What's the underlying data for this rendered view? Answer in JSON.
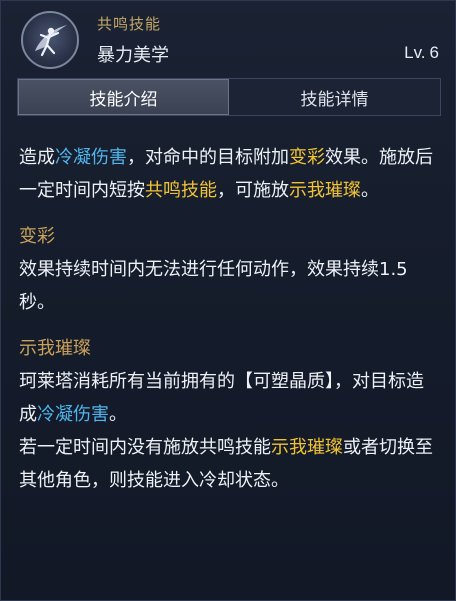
{
  "header": {
    "category": "共鸣技能",
    "skill_name": "暴力美学",
    "level_prefix": "Lv.",
    "level": "6",
    "icon": "dancer-silhouette-icon"
  },
  "tabs": [
    {
      "label": "技能介绍",
      "active": true
    },
    {
      "label": "技能详情",
      "active": false
    }
  ],
  "colors": {
    "frost_blue": "#4fb5ec",
    "highlight_gold": "#f2c334",
    "section_title": "#c9a15b",
    "category_gold": "#c2a766"
  },
  "description": {
    "p1": [
      "造成",
      "冷凝伤害",
      "，对命中的目标附加",
      "变彩",
      "效果。施放后一定时间内短按",
      "共鸣技能",
      "，可施放",
      "示我璀璨",
      "。"
    ],
    "section1": {
      "title": "变彩",
      "text": "效果持续时间内无法进行任何动作，效果持续1.5秒。"
    },
    "section2": {
      "title": "示我璀璨",
      "line1": [
        "珂莱塔消耗所有当前拥有的【可塑晶质】，对目标造成",
        "冷凝伤害",
        "。"
      ],
      "line2": [
        "若一定时间内没有施放共鸣技能",
        "示我璀璨",
        "或者切换至其他角色，则技能进入冷却状态。"
      ]
    }
  }
}
